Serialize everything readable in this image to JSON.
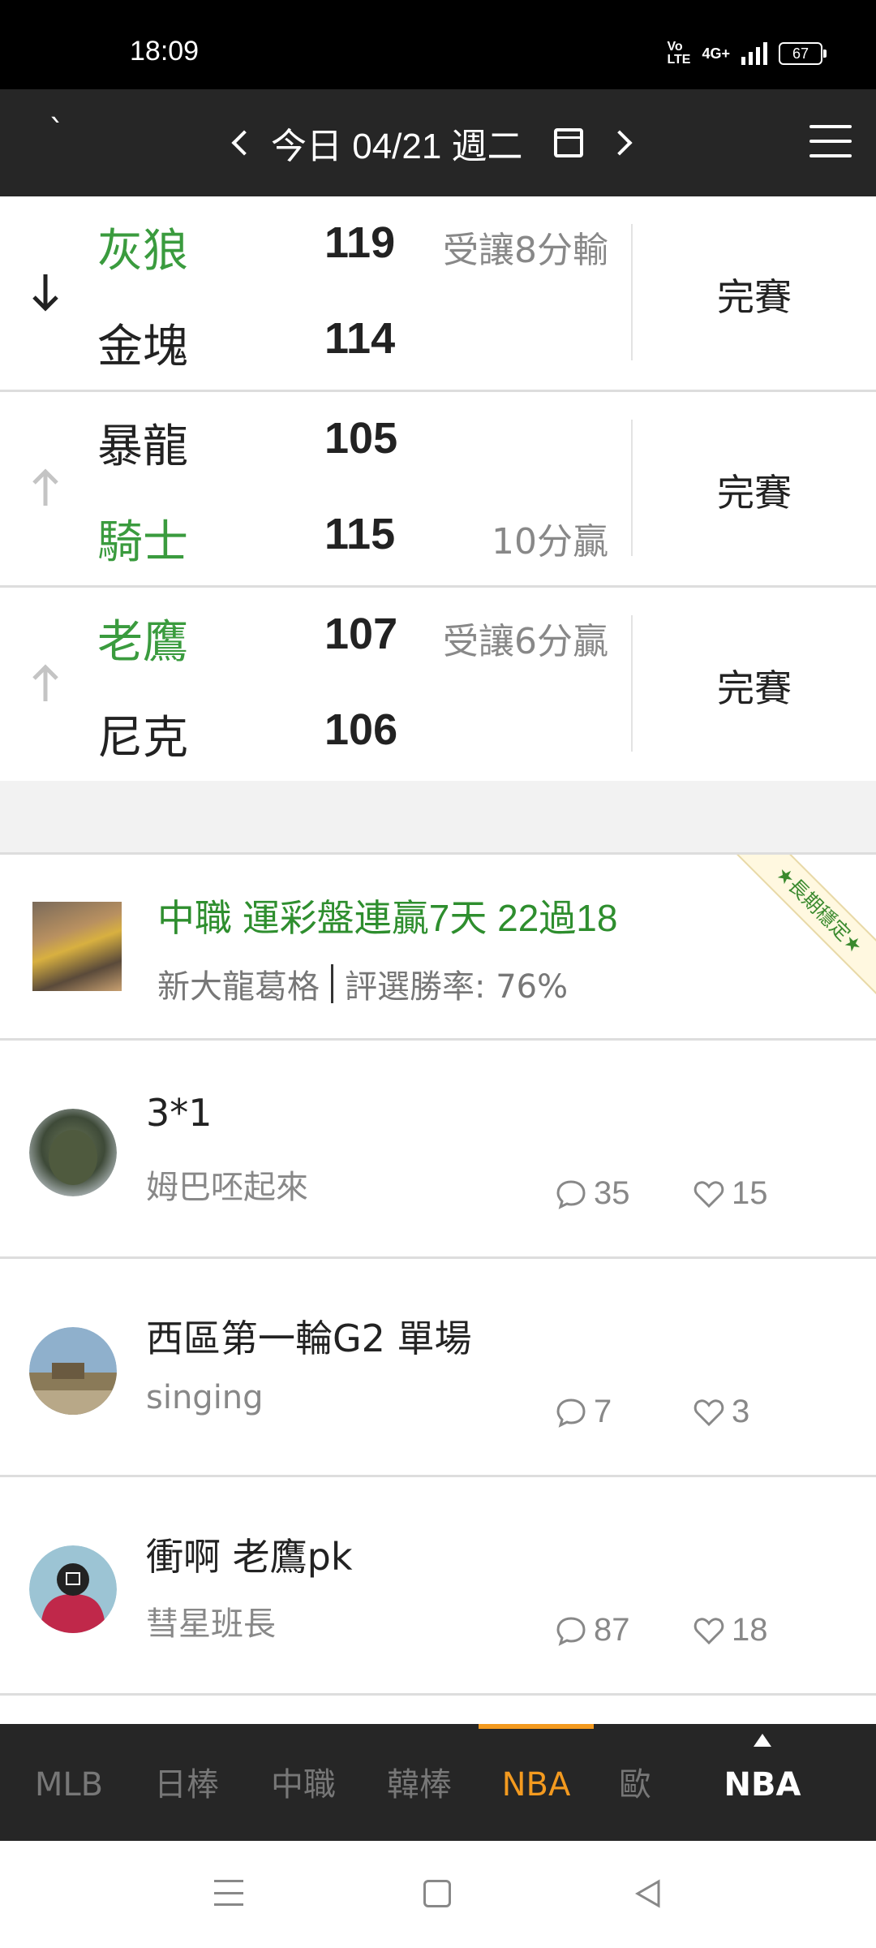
{
  "status_bar": {
    "time": "18:09",
    "volte": "Vo\nLTE",
    "network": "4G+",
    "battery": "67"
  },
  "header": {
    "date_label": "今日 04/21 週二"
  },
  "games": [
    {
      "arrow": "down",
      "team1": "灰狼",
      "score1": "119",
      "note1": "受讓8分輸",
      "team2": "金塊",
      "score2": "114",
      "note2": "",
      "winner": 1,
      "status": "完賽"
    },
    {
      "arrow": "up",
      "team1": "暴龍",
      "score1": "105",
      "note1": "",
      "team2": "騎士",
      "score2": "115",
      "note2": "10分贏",
      "winner": 2,
      "status": "完賽"
    },
    {
      "arrow": "up",
      "team1": "老鷹",
      "score1": "107",
      "note1": "受讓6分贏",
      "team2": "尼克",
      "score2": "106",
      "note2": "",
      "winner": 1,
      "status": "完賽"
    }
  ],
  "featured": {
    "title": "中職 運彩盤連贏7天 22過18",
    "author": "新大龍葛格",
    "rate": "評選勝率: 76%",
    "ribbon": "★長期穩定★"
  },
  "posts": [
    {
      "title": "3*1",
      "author": "姆巴呸起來",
      "comments": "35",
      "likes": "15"
    },
    {
      "title": "西區第一輪G2 單場",
      "author": "singing",
      "comments": "7",
      "likes": "3"
    },
    {
      "title": "衝啊 老鷹pk",
      "author": "彗星班長",
      "comments": "87",
      "likes": "18"
    }
  ],
  "tabs": [
    "MLB",
    "日棒",
    "中職",
    "韓棒",
    "NBA",
    "歐"
  ],
  "active_tab": "NBA",
  "sport_selector": "NBA",
  "colors": {
    "win_green": "#3a9b3e",
    "accent_orange": "#f39a1f",
    "header_bg": "#262626"
  }
}
